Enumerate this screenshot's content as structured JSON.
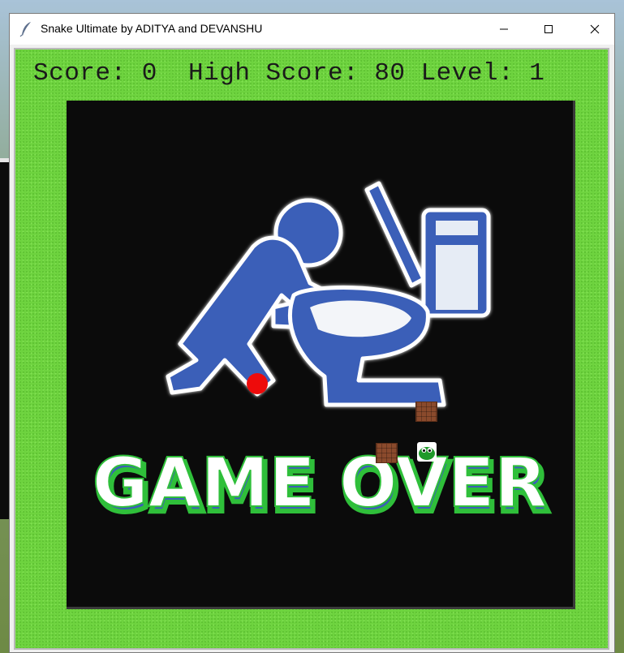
{
  "window": {
    "title": "Snake Ultimate by ADITYA and DEVANSHU"
  },
  "controls": {
    "minimize": "minimize-icon",
    "maximize": "maximize-icon",
    "close": "close-icon"
  },
  "hud": {
    "score_text": "Score: 0  High Score: 80 Level: 1",
    "score": 0,
    "high_score": 80,
    "level": 1
  },
  "board": {
    "banner": "GAME OVER",
    "colors": {
      "field": "#6ed33f",
      "board": "#0b0b0b",
      "figure": "#3b5fb8",
      "food": "#ee0b0b"
    }
  },
  "icons": [
    "feather-icon",
    "snake-head-icon",
    "brick-icon",
    "food-icon"
  ]
}
